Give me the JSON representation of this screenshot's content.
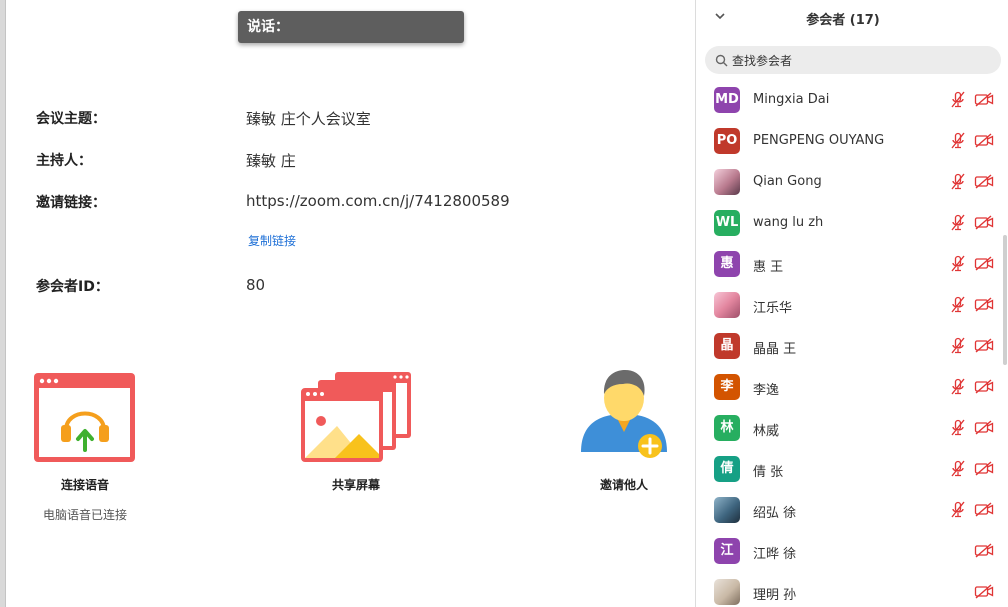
{
  "main": {
    "speaking_label": "说话：",
    "info": [
      {
        "label": "会议主题：",
        "value": "臻敏 庄个人会议室"
      },
      {
        "label": "主持人：",
        "value": "臻敏 庄"
      },
      {
        "label": "邀请链接：",
        "value": "https://zoom.com.cn/j/7412800589"
      },
      {
        "label": "参会者ID：",
        "value": "80"
      }
    ],
    "copy_link": "复制链接",
    "actions": {
      "audio": {
        "label": "连接语音",
        "sub": "电脑语音已连接"
      },
      "share": {
        "label": "共享屏幕"
      },
      "invite": {
        "label": "邀请他人"
      }
    }
  },
  "panel": {
    "title": "参会者 (17)",
    "search_placeholder": "查找参会者",
    "participants": [
      {
        "initials": "MD",
        "name": "Mingxia Dai",
        "color": "#8e44ad",
        "mic_muted": true,
        "cam_off": true
      },
      {
        "initials": "PO",
        "name": "PENGPENG OUYANG",
        "color": "#c0392b",
        "mic_muted": true,
        "cam_off": true
      },
      {
        "initials": "",
        "name": "Qian Gong",
        "photo": true,
        "mic_muted": true,
        "cam_off": true
      },
      {
        "initials": "WL",
        "name": "wang lu zh",
        "color": "#27ae60",
        "mic_muted": true,
        "cam_off": true
      },
      {
        "initials": "惠",
        "name": "惠 王",
        "color": "#8e44ad",
        "mic_muted": true,
        "cam_off": true
      },
      {
        "initials": "",
        "name": "江乐华",
        "photo": true,
        "mic_muted": true,
        "cam_off": true
      },
      {
        "initials": "晶",
        "name": "晶晶 王",
        "color": "#c0392b",
        "mic_muted": true,
        "cam_off": true
      },
      {
        "initials": "李",
        "name": "李逸",
        "color": "#d35400",
        "mic_muted": true,
        "cam_off": true
      },
      {
        "initials": "林",
        "name": "林威",
        "color": "#27ae60",
        "mic_muted": true,
        "cam_off": true
      },
      {
        "initials": "倩",
        "name": "倩 张",
        "color": "#16a085",
        "mic_muted": true,
        "cam_off": true
      },
      {
        "initials": "",
        "name": "绍弘 徐",
        "photo": true,
        "mic_muted": true,
        "cam_off": true
      },
      {
        "initials": "江",
        "name": "江晔 徐",
        "color": "#8e44ad",
        "mic_muted": false,
        "cam_off": true
      },
      {
        "initials": "",
        "name": "理明 孙",
        "photo": true,
        "mic_muted": false,
        "cam_off": true
      }
    ]
  },
  "colors": {
    "accent_red": "#f05a5a",
    "link_blue": "#1d6fd6",
    "muted_icon": "#e03535"
  },
  "icons": {
    "collapse": "chevron-down-icon",
    "search": "search-icon",
    "mic": "mic-muted-icon",
    "cam": "video-off-icon"
  }
}
